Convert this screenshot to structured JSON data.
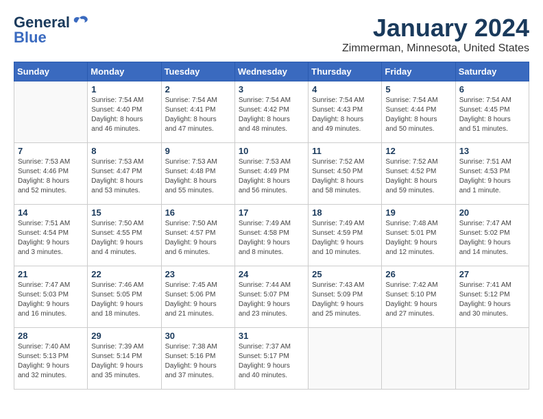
{
  "header": {
    "logo_general": "General",
    "logo_blue": "Blue",
    "month_title": "January 2024",
    "location": "Zimmerman, Minnesota, United States"
  },
  "days_of_week": [
    "Sunday",
    "Monday",
    "Tuesday",
    "Wednesday",
    "Thursday",
    "Friday",
    "Saturday"
  ],
  "weeks": [
    [
      {
        "day": "",
        "info": ""
      },
      {
        "day": "1",
        "info": "Sunrise: 7:54 AM\nSunset: 4:40 PM\nDaylight: 8 hours\nand 46 minutes."
      },
      {
        "day": "2",
        "info": "Sunrise: 7:54 AM\nSunset: 4:41 PM\nDaylight: 8 hours\nand 47 minutes."
      },
      {
        "day": "3",
        "info": "Sunrise: 7:54 AM\nSunset: 4:42 PM\nDaylight: 8 hours\nand 48 minutes."
      },
      {
        "day": "4",
        "info": "Sunrise: 7:54 AM\nSunset: 4:43 PM\nDaylight: 8 hours\nand 49 minutes."
      },
      {
        "day": "5",
        "info": "Sunrise: 7:54 AM\nSunset: 4:44 PM\nDaylight: 8 hours\nand 50 minutes."
      },
      {
        "day": "6",
        "info": "Sunrise: 7:54 AM\nSunset: 4:45 PM\nDaylight: 8 hours\nand 51 minutes."
      }
    ],
    [
      {
        "day": "7",
        "info": "Sunrise: 7:53 AM\nSunset: 4:46 PM\nDaylight: 8 hours\nand 52 minutes."
      },
      {
        "day": "8",
        "info": "Sunrise: 7:53 AM\nSunset: 4:47 PM\nDaylight: 8 hours\nand 53 minutes."
      },
      {
        "day": "9",
        "info": "Sunrise: 7:53 AM\nSunset: 4:48 PM\nDaylight: 8 hours\nand 55 minutes."
      },
      {
        "day": "10",
        "info": "Sunrise: 7:53 AM\nSunset: 4:49 PM\nDaylight: 8 hours\nand 56 minutes."
      },
      {
        "day": "11",
        "info": "Sunrise: 7:52 AM\nSunset: 4:50 PM\nDaylight: 8 hours\nand 58 minutes."
      },
      {
        "day": "12",
        "info": "Sunrise: 7:52 AM\nSunset: 4:52 PM\nDaylight: 8 hours\nand 59 minutes."
      },
      {
        "day": "13",
        "info": "Sunrise: 7:51 AM\nSunset: 4:53 PM\nDaylight: 9 hours\nand 1 minute."
      }
    ],
    [
      {
        "day": "14",
        "info": "Sunrise: 7:51 AM\nSunset: 4:54 PM\nDaylight: 9 hours\nand 3 minutes."
      },
      {
        "day": "15",
        "info": "Sunrise: 7:50 AM\nSunset: 4:55 PM\nDaylight: 9 hours\nand 4 minutes."
      },
      {
        "day": "16",
        "info": "Sunrise: 7:50 AM\nSunset: 4:57 PM\nDaylight: 9 hours\nand 6 minutes."
      },
      {
        "day": "17",
        "info": "Sunrise: 7:49 AM\nSunset: 4:58 PM\nDaylight: 9 hours\nand 8 minutes."
      },
      {
        "day": "18",
        "info": "Sunrise: 7:49 AM\nSunset: 4:59 PM\nDaylight: 9 hours\nand 10 minutes."
      },
      {
        "day": "19",
        "info": "Sunrise: 7:48 AM\nSunset: 5:01 PM\nDaylight: 9 hours\nand 12 minutes."
      },
      {
        "day": "20",
        "info": "Sunrise: 7:47 AM\nSunset: 5:02 PM\nDaylight: 9 hours\nand 14 minutes."
      }
    ],
    [
      {
        "day": "21",
        "info": "Sunrise: 7:47 AM\nSunset: 5:03 PM\nDaylight: 9 hours\nand 16 minutes."
      },
      {
        "day": "22",
        "info": "Sunrise: 7:46 AM\nSunset: 5:05 PM\nDaylight: 9 hours\nand 18 minutes."
      },
      {
        "day": "23",
        "info": "Sunrise: 7:45 AM\nSunset: 5:06 PM\nDaylight: 9 hours\nand 21 minutes."
      },
      {
        "day": "24",
        "info": "Sunrise: 7:44 AM\nSunset: 5:07 PM\nDaylight: 9 hours\nand 23 minutes."
      },
      {
        "day": "25",
        "info": "Sunrise: 7:43 AM\nSunset: 5:09 PM\nDaylight: 9 hours\nand 25 minutes."
      },
      {
        "day": "26",
        "info": "Sunrise: 7:42 AM\nSunset: 5:10 PM\nDaylight: 9 hours\nand 27 minutes."
      },
      {
        "day": "27",
        "info": "Sunrise: 7:41 AM\nSunset: 5:12 PM\nDaylight: 9 hours\nand 30 minutes."
      }
    ],
    [
      {
        "day": "28",
        "info": "Sunrise: 7:40 AM\nSunset: 5:13 PM\nDaylight: 9 hours\nand 32 minutes."
      },
      {
        "day": "29",
        "info": "Sunrise: 7:39 AM\nSunset: 5:14 PM\nDaylight: 9 hours\nand 35 minutes."
      },
      {
        "day": "30",
        "info": "Sunrise: 7:38 AM\nSunset: 5:16 PM\nDaylight: 9 hours\nand 37 minutes."
      },
      {
        "day": "31",
        "info": "Sunrise: 7:37 AM\nSunset: 5:17 PM\nDaylight: 9 hours\nand 40 minutes."
      },
      {
        "day": "",
        "info": ""
      },
      {
        "day": "",
        "info": ""
      },
      {
        "day": "",
        "info": ""
      }
    ]
  ]
}
